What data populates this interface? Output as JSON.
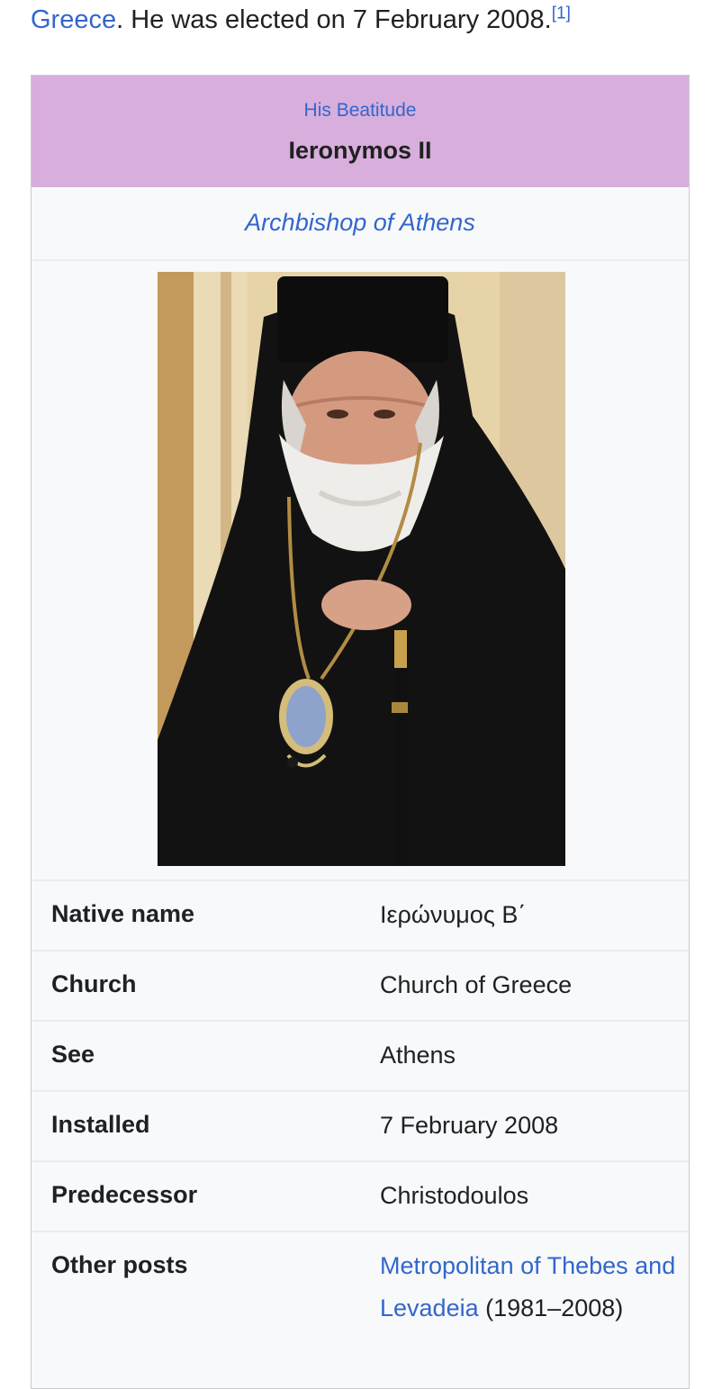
{
  "intro": {
    "link_text": "Greece",
    "text": ". He was elected on 7 February 2008.",
    "footnote": "[1]"
  },
  "infobox": {
    "honorific": "His Beatitude",
    "name": "Ieronymos II",
    "see_title": "Archbishop of Athens",
    "photo": {
      "description": "Portrait of Ieronymos II in black clerical robes with white beard",
      "background_color": "#e5cfa2",
      "robe_color": "#161616"
    },
    "rows": [
      {
        "label": "Native name",
        "value": "Ιερώνυμος Β΄",
        "type": "text"
      },
      {
        "label": "Church",
        "value": "Church of Greece",
        "type": "link"
      },
      {
        "label": "See",
        "value": "Athens",
        "type": "visited-link"
      },
      {
        "label": "Installed",
        "value": "7 February 2008",
        "type": "text"
      },
      {
        "label": "Predecessor",
        "value": "Christodoulos",
        "type": "link"
      },
      {
        "label": "Other posts",
        "value_link": "Metropolitan of Thebes and Levadeia",
        "value_suffix": "(1981–2008)",
        "type": "mixed"
      }
    ]
  },
  "colors": {
    "link": "#3366cc",
    "visited_link": "#6b4ba1",
    "title_background": "#d8aedc",
    "infobox_background": "#f8f9fa",
    "border": "#eaecf0"
  }
}
